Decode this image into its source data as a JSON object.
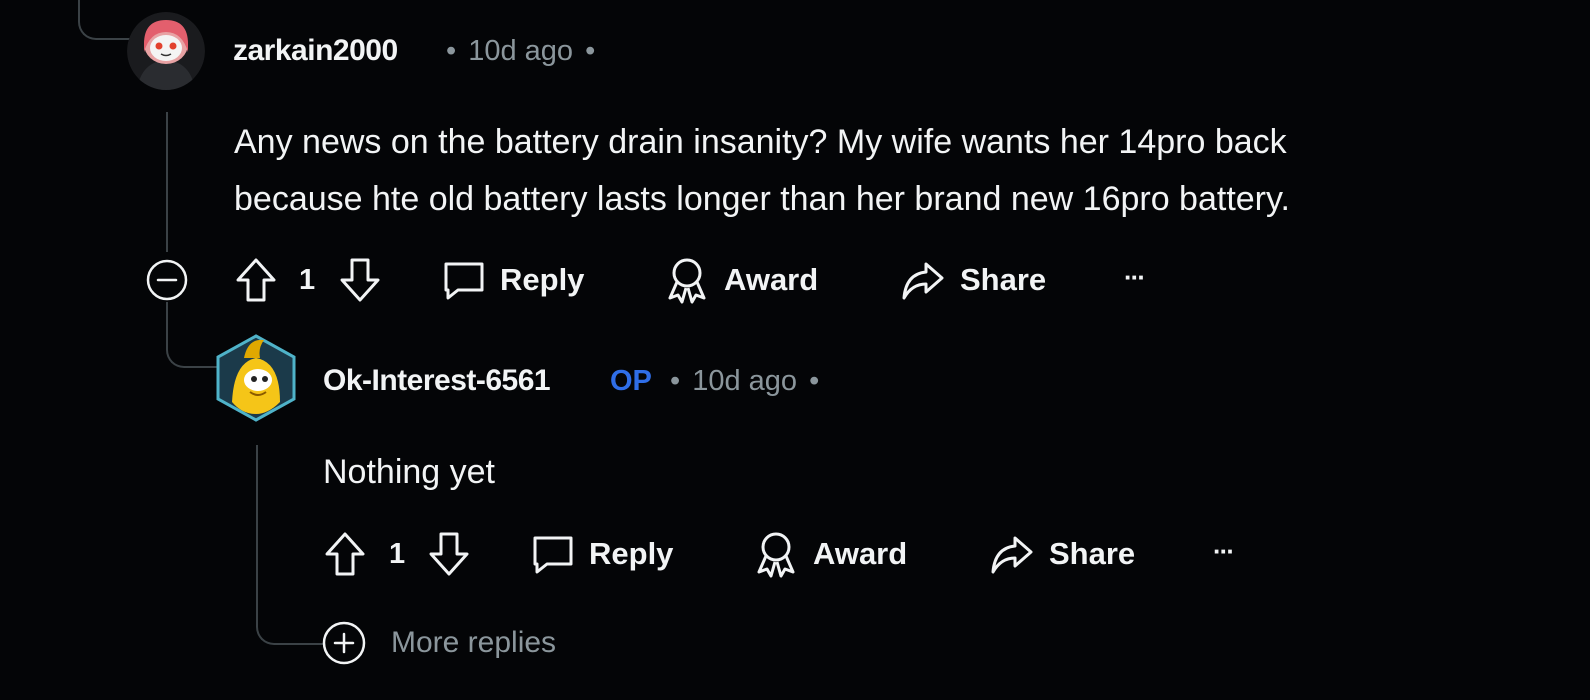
{
  "comments": [
    {
      "author": "zarkain2000",
      "age": "10d ago",
      "body_lines": [
        "Any news on the battery drain insanity? My wife wants her 14pro back",
        "because hte old battery lasts longer than her brand new 16pro battery."
      ],
      "votes": "1",
      "actions": {
        "reply": "Reply",
        "award": "Award",
        "share": "Share",
        "more": "···"
      }
    },
    {
      "author": "Ok-Interest-6561",
      "op_badge": "OP",
      "age": "10d ago",
      "body_lines": [
        "Nothing yet"
      ],
      "votes": "1",
      "actions": {
        "reply": "Reply",
        "award": "Award",
        "share": "Share",
        "more": "···"
      }
    }
  ],
  "more_replies": "More replies",
  "separator": "•",
  "colors": {
    "background": "#040507",
    "text": "#f2f4f5",
    "muted": "#8b969c",
    "op": "#2f6ee8",
    "thread_line": "#3b4246"
  }
}
